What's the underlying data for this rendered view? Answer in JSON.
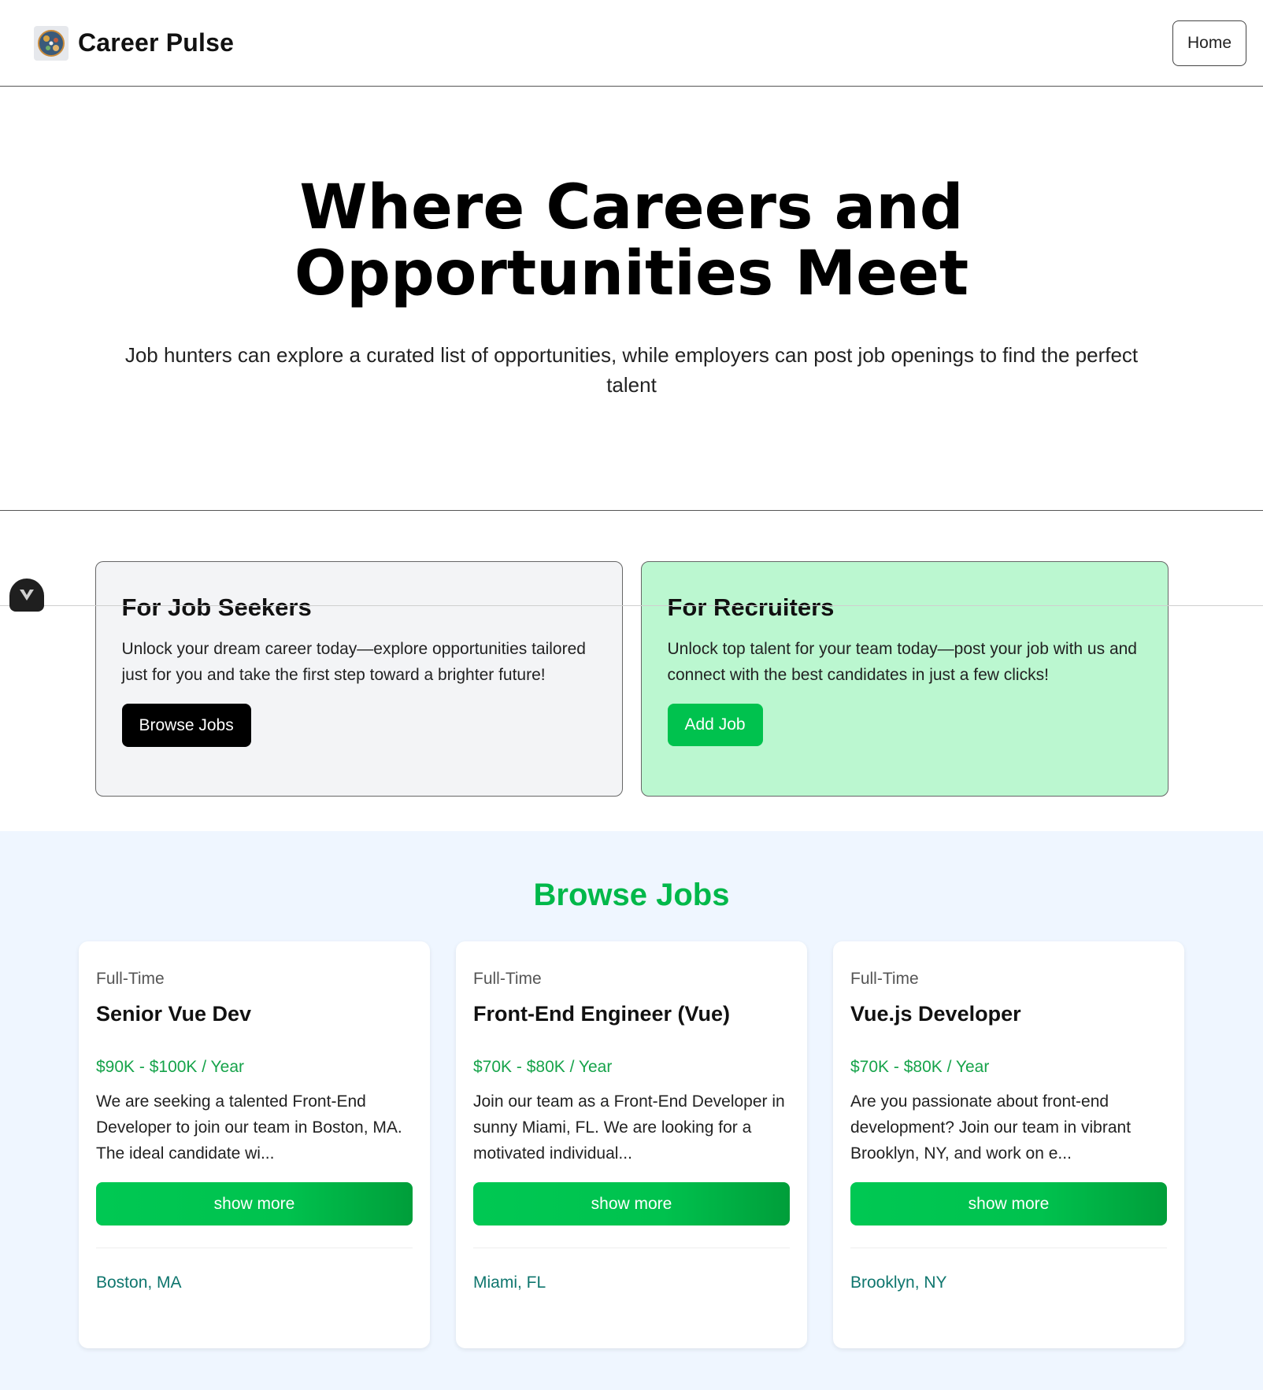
{
  "header": {
    "brand_name": "Career Pulse",
    "logo_icon": "globe-logo-icon",
    "nav_home_label": "Home"
  },
  "hero": {
    "title_line1": "Where Careers and",
    "title_line2": "Opportunities Meet",
    "subtitle": "Job hunters can explore a curated list of opportunities, while employers can post job openings to find the perfect talent"
  },
  "roles": {
    "seekers": {
      "title": "For Job Seekers",
      "description": "Unlock your dream career today—explore opportunities tailored just for you and take the first step toward a brighter future!",
      "button_label": "Browse Jobs"
    },
    "recruiters": {
      "title": "For Recruiters",
      "description": "Unlock top talent for your team today—post your job with us and connect with the best candidates in just a few clicks!",
      "button_label": "Add Job"
    }
  },
  "browse": {
    "heading": "Browse Jobs",
    "jobs": [
      {
        "type": "Full-Time",
        "title": "Senior Vue Dev",
        "salary": "$90K - $100K / Year",
        "description": "We are seeking a talented Front-End Developer to join our team in Boston, MA. The ideal candidate wi...",
        "button_label": "show more",
        "location": "Boston, MA"
      },
      {
        "type": "Full-Time",
        "title": "Front-End Engineer (Vue)",
        "salary": "$70K - $80K / Year",
        "description": "Join our team as a Front-End Developer in sunny Miami, FL. We are looking for a motivated individual...",
        "button_label": "show more",
        "location": "Miami, FL"
      },
      {
        "type": "Full-Time",
        "title": "Vue.js Developer",
        "salary": "$70K - $80K / Year",
        "description": "Are you passionate about front-end development? Join our team in vibrant Brooklyn, NY, and work on e...",
        "button_label": "show more",
        "location": "Brooklyn, NY"
      }
    ]
  },
  "devtools": {
    "badge_icon": "vue-devtools-icon",
    "badge_letter": "V"
  },
  "colors": {
    "accent_green": "#00c24e",
    "salary_green": "#16a34a",
    "recruiter_bg": "#bbf7d0",
    "seeker_bg": "#f3f4f6",
    "browse_bg": "#eff6ff",
    "location_teal": "#0f766e"
  }
}
